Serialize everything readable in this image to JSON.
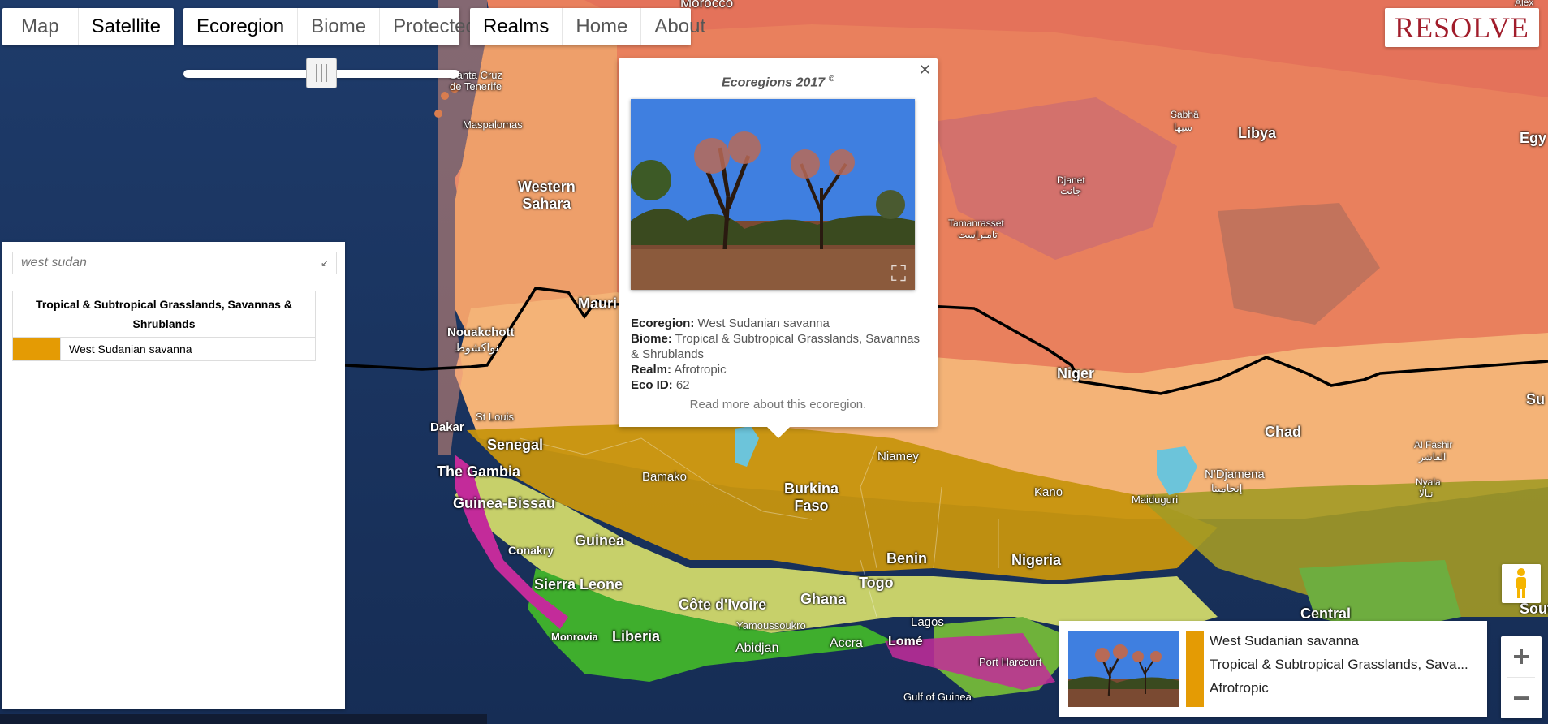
{
  "map_type": {
    "options": [
      "Map",
      "Satellite"
    ],
    "active": "Satellite"
  },
  "layers": {
    "options": [
      "Ecoregion",
      "Biome",
      "Protected"
    ],
    "active": "Ecoregion"
  },
  "nav": {
    "options": [
      "Realms",
      "Home",
      "About"
    ],
    "active": "Realms"
  },
  "logo": "RESOLVE",
  "opacity_slider_value": 0.5,
  "search": {
    "value": "west sudan",
    "collapse_icon": "arrow-collapse-icon"
  },
  "results": {
    "biome": "Tropical & Subtropical Grasslands, Savannas & Shrublands",
    "items": [
      {
        "name": "West Sudanian savanna",
        "color": "#e49b04"
      }
    ]
  },
  "popup": {
    "title": "Ecoregions 2017",
    "copyright": "©",
    "ecoregion_label": "Ecoregion:",
    "ecoregion": "West Sudanian savanna",
    "biome_label": "Biome:",
    "biome": "Tropical & Subtropical Grasslands, Savannas & Shrublands",
    "realm_label": "Realm:",
    "realm": "Afrotropic",
    "ecoid_label": "Eco ID:",
    "ecoid": "62",
    "read_more": "Read more about this ecoregion."
  },
  "bottom_card": {
    "name": "West Sudanian savanna",
    "biome": "Tropical & Subtropical Grasslands, Sava...",
    "realm": "Afrotropic",
    "color": "#e49b04"
  },
  "zoom": {
    "in": "+",
    "out": "−"
  },
  "map_labels": {
    "morocco": "Morocco",
    "western_sahara": "Western\nSahara",
    "libya": "Libya",
    "chad": "Chad",
    "niger": "Niger",
    "senegal": "Senegal",
    "the_gambia": "The Gambia",
    "guinea_bissau": "Guinea-Bissau",
    "guinea": "Guinea",
    "sierra_leone": "Sierra Leone",
    "liberia": "Liberia",
    "cote_divoire": "Côte d'Ivoire",
    "ghana": "Ghana",
    "togo": "Togo",
    "benin": "Benin",
    "nigeria": "Nigeria",
    "burkina_faso": "Burkina\nFaso",
    "central": "Central",
    "mauritania": "Mauri",
    "egypt": "Egy",
    "south": "South S",
    "sudan": "Su",
    "santa_cruz": "Santa Cruz\nde Tenerife",
    "maspalomas": "Maspalomas",
    "nouakchott": "Nouakchott",
    "nouakchott_ar": "نواكشوط",
    "dakar": "Dakar",
    "st_louis": "St Louis",
    "bamako": "Bamako",
    "niamey": "Niamey",
    "kano": "Kano",
    "ndjamena": "N'Djamena",
    "ndjamena_ar": "إنجامينا",
    "maiduguri": "Maiduguri",
    "conakry": "Conakry",
    "monrovia": "Monrovia",
    "yamoussoukro": "Yamoussoukro",
    "abidjan": "Abidjan",
    "accra": "Accra",
    "lome": "Lomé",
    "lagos": "Lagos",
    "port_harcourt": "Port Harcourt",
    "gulf_of_guinea": "Gulf of Guinea",
    "sabha": "Sabhā",
    "sabha_ar": "سبها",
    "djanet": "Djanet",
    "djanet_ar": "جانت",
    "tamanrasset": "Tamanrasset",
    "tamanrasset_ar": "تامنراست",
    "al_fashir": "Al Fashir",
    "al_fashir_ar": "الفاشر",
    "nyala": "Nyala",
    "nyala_ar": "نيالا",
    "alex": "Alex"
  }
}
